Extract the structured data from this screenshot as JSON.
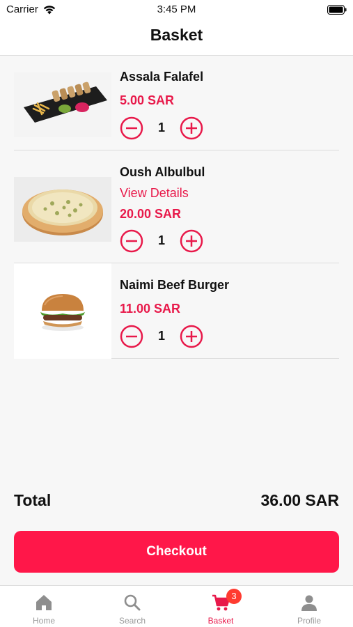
{
  "status_bar": {
    "carrier": "Carrier",
    "time": "3:45 PM"
  },
  "nav": {
    "title": "Basket"
  },
  "items": [
    {
      "name": "Assala Falafel",
      "price": "5.00 SAR",
      "quantity": "1",
      "image": "falafel-platter-image"
    },
    {
      "name": "Oush Albulbul",
      "details_link": "View Details",
      "price": "20.00 SAR",
      "quantity": "1",
      "image": "pizza-image"
    },
    {
      "name": "Naimi Beef Burger",
      "price": "11.00 SAR",
      "quantity": "1",
      "image": "burger-image"
    }
  ],
  "summary": {
    "total_label": "Total",
    "total_value": "36.00 SAR"
  },
  "checkout": {
    "label": "Checkout"
  },
  "tabs": [
    {
      "label": "Home",
      "icon": "home-icon"
    },
    {
      "label": "Search",
      "icon": "search-icon"
    },
    {
      "label": "Basket",
      "icon": "cart-icon",
      "badge": "3",
      "active": true
    },
    {
      "label": "Profile",
      "icon": "person-icon"
    }
  ],
  "colors": {
    "accent": "#e8194a",
    "checkout_bg": "#ff1749",
    "badge": "#ff3b30"
  }
}
